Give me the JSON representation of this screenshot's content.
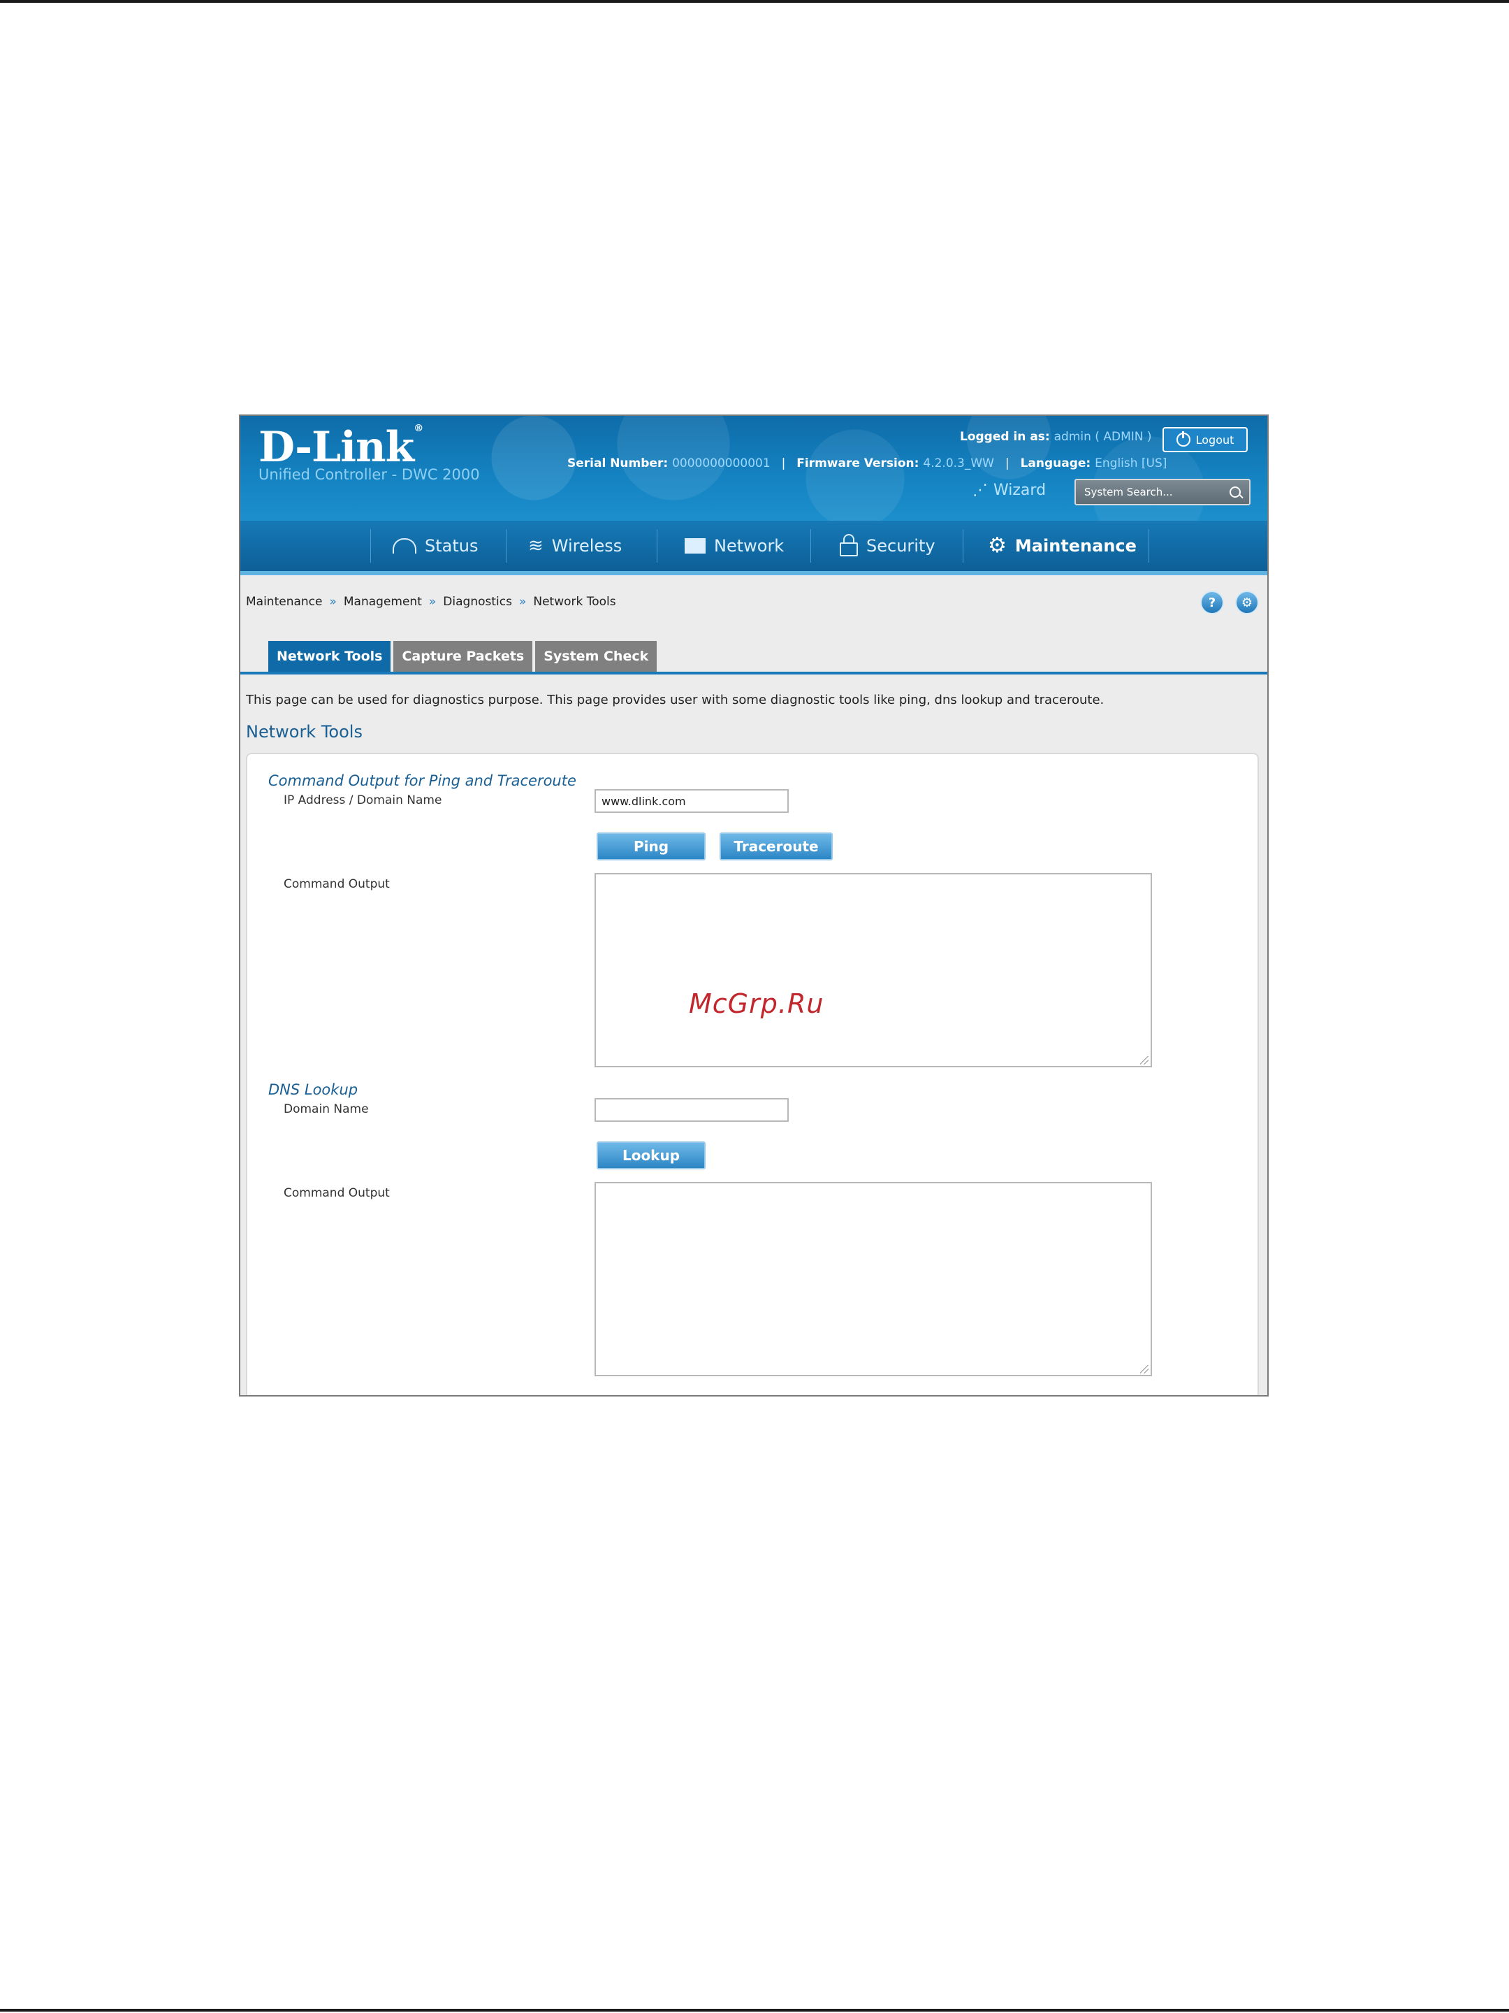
{
  "header": {
    "logo_text": "D-Link",
    "logo_mark": "®",
    "subtitle": "Unified Controller - DWC 2000",
    "logged_in_label": "Logged in as:",
    "logged_in_value": "admin ( ADMIN )",
    "logout_label": "Logout",
    "serial_label": "Serial Number:",
    "serial_value": "0000000000001",
    "firmware_label": "Firmware Version:",
    "firmware_value": "4.2.0.3_WW",
    "language_label": "Language:",
    "language_value": "English [US]",
    "wizard_label": "Wizard",
    "search_placeholder": "System Search..."
  },
  "nav": {
    "items": [
      {
        "label": "Status",
        "icon": "gauge-icon"
      },
      {
        "label": "Wireless",
        "icon": "wifi-icon"
      },
      {
        "label": "Network",
        "icon": "monitor-icon"
      },
      {
        "label": "Security",
        "icon": "lock-icon"
      },
      {
        "label": "Maintenance",
        "icon": "gears-icon",
        "active": true
      }
    ]
  },
  "breadcrumb": [
    "Maintenance",
    "Management",
    "Diagnostics",
    "Network Tools"
  ],
  "breadcrumb_separator": "»",
  "help_buttons": {
    "help": "?",
    "config": "⚙"
  },
  "tabs": [
    {
      "label": "Network Tools",
      "active": true
    },
    {
      "label": "Capture Packets"
    },
    {
      "label": "System Check"
    }
  ],
  "description": "This page can be used for diagnostics purpose. This page provides user with some diagnostic tools like ping, dns lookup and traceroute.",
  "page_title": "Network Tools",
  "ping_section": {
    "title": "Command Output for Ping and Traceroute",
    "address_label": "IP Address / Domain Name",
    "address_value": "www.dlink.com",
    "ping_button": "Ping",
    "traceroute_button": "Traceroute",
    "output_label": "Command Output"
  },
  "dns_section": {
    "title": "DNS Lookup",
    "domain_label": "Domain Name",
    "domain_value": "",
    "lookup_button": "Lookup",
    "output_label": "Command Output"
  },
  "watermark": "McGrp.Ru",
  "colors": {
    "brand_blue": "#1583c2",
    "tab_active": "#106aa8",
    "tab_inactive": "#808080",
    "watermark": "#c1272d"
  }
}
